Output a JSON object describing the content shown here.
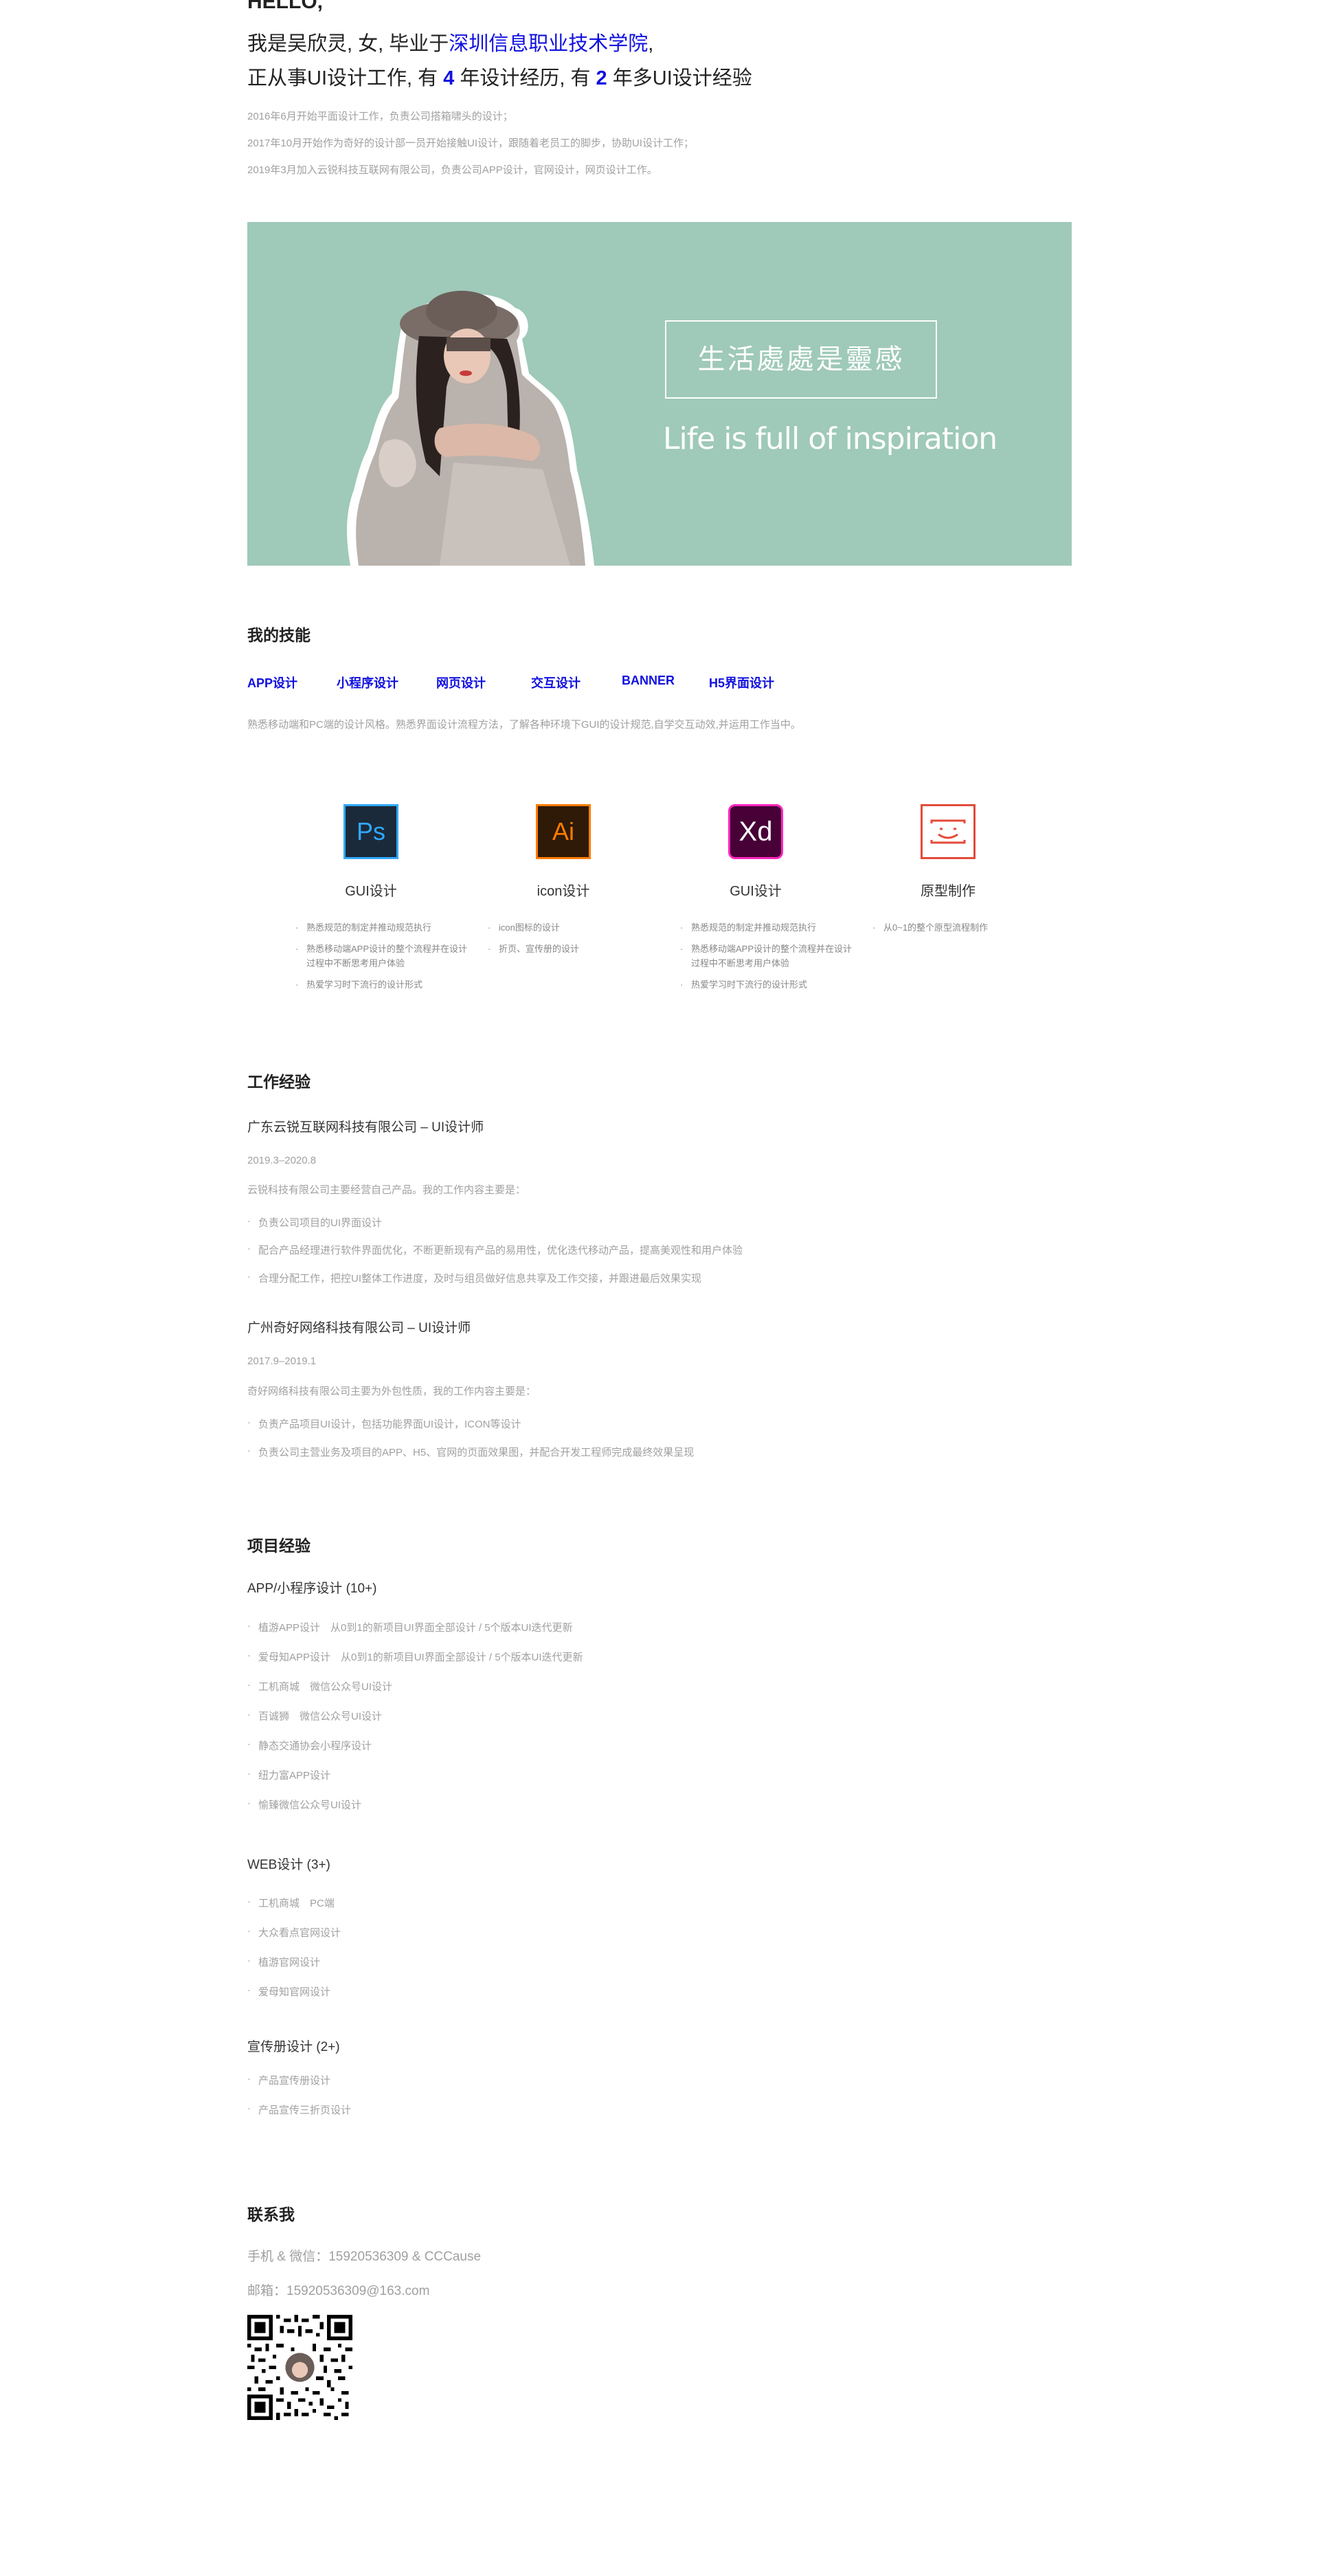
{
  "intro": {
    "hello": "HELLO,",
    "line1_a": "我是吴欣灵, 女, 毕业于",
    "line1_school": "深圳信息职业技术学院",
    "line1_b": ",",
    "line2_a": "正从事UI设计工作, 有 ",
    "line2_years1": "4",
    "line2_b": " 年设计经历, 有 ",
    "line2_years2": "2",
    "line2_c": " 年多UI设计经验",
    "notes": [
      "2016年6月开始平面设计工作，负责公司搭箱啸头的设计；",
      "2017年10月开始作为奇好的设计部一员开始接触UI设计，跟随着老员工的脚步，协助UI设计工作；",
      "2019年3月加入云锐科技互联网有限公司，负责公司APP设计，官网设计，网页设计工作。"
    ]
  },
  "banner": {
    "cn": "生活處處是靈感",
    "en": "Life is full of inspiration",
    "bg_color": "#9fc9b9"
  },
  "skills": {
    "title": "我的技能",
    "tags": [
      "APP设计",
      "小程序设计",
      "网页设计",
      "交互设计",
      "BANNER",
      "H5界面设计"
    ],
    "desc": "熟悉移动端和PC端的设计风格。熟悉界面设计流程方法，了解各种环境下GUI的设计规范,自学交互动效,并运用工作当中。",
    "tools": [
      {
        "icon": "Ps",
        "icon_name": "photoshop-icon",
        "name": "GUI设计",
        "items": [
          "熟悉规范的制定并推动规范执行",
          "熟悉移动端APP设计的整个流程并在设计过程中不断思考用户体验",
          "热爱学习时下流行的设计形式"
        ]
      },
      {
        "icon": "Ai",
        "icon_name": "illustrator-icon",
        "name": "icon设计",
        "items": [
          "icon图标的设计",
          "折页、宣传册的设计"
        ]
      },
      {
        "icon": "Xd",
        "icon_name": "xd-icon",
        "name": "GUI设计",
        "items": [
          "熟悉规范的制定并推动规范执行",
          "熟悉移动端APP设计的整个流程并在设计过程中不断思考用户体验",
          "热爱学习时下流行的设计形式"
        ]
      },
      {
        "icon": "",
        "icon_name": "prototype-icon",
        "name": "原型制作",
        "items": [
          "从0~1的整个原型流程制作"
        ]
      }
    ]
  },
  "work": {
    "title": "工作经验",
    "jobs": [
      {
        "title": "广东云锐互联网科技有限公司 – UI设计师",
        "date": "2019.3–2020.8",
        "intro": "云锐科技有限公司主要经营自己产品。我的工作内容主要是：",
        "items": [
          "负责公司项目的UI界面设计",
          "配合产品经理进行软件界面优化，不断更新现有产品的易用性，优化迭代移动产品，提高美观性和用户体验",
          "合理分配工作，把控UI整体工作进度，及时与组员做好信息共享及工作交接，并跟进最后效果实现"
        ]
      },
      {
        "title": "广州奇好网络科技有限公司 – UI设计师",
        "date": "2017.9–2019.1",
        "intro": "奇好网络科技有限公司主要为外包性质，我的工作内容主要是：",
        "items": [
          "负责产品项目UI设计，包括功能界面UI设计，ICON等设计",
          "负责公司主营业务及项目的APP、H5、官网的页面效果图，并配合开发工程师完成最终效果呈现"
        ]
      }
    ]
  },
  "projects": {
    "title": "项目经验",
    "groups": [
      {
        "title": "APP/小程序设计 (10+)",
        "items": [
          "植游APP设计　从0到1的新项目UI界面全部设计 / 5个版本UI迭代更新",
          "爱母知APP设计　从0到1的新项目UI界面全部设计 / 5个版本UI迭代更新",
          "工机商城　微信公众号UI设计",
          "百诚狮　微信公众号UI设计",
          "静态交通协会小程序设计",
          "纽力富APP设计",
          "愉臻微信公众号UI设计"
        ]
      },
      {
        "title": "WEB设计 (3+)",
        "items": [
          "工机商城　PC端",
          "大众看点官网设计",
          "植游官网设计",
          "爱母知官网设计"
        ]
      },
      {
        "title": "宣传册设计 (2+)",
        "items": [
          "产品宣传册设计",
          "产品宣传三折页设计"
        ]
      }
    ]
  },
  "contact": {
    "title": "联系我",
    "phone": "手机 & 微信：15920536309 & CCCause",
    "email": "邮箱：15920536309@163.com"
  }
}
